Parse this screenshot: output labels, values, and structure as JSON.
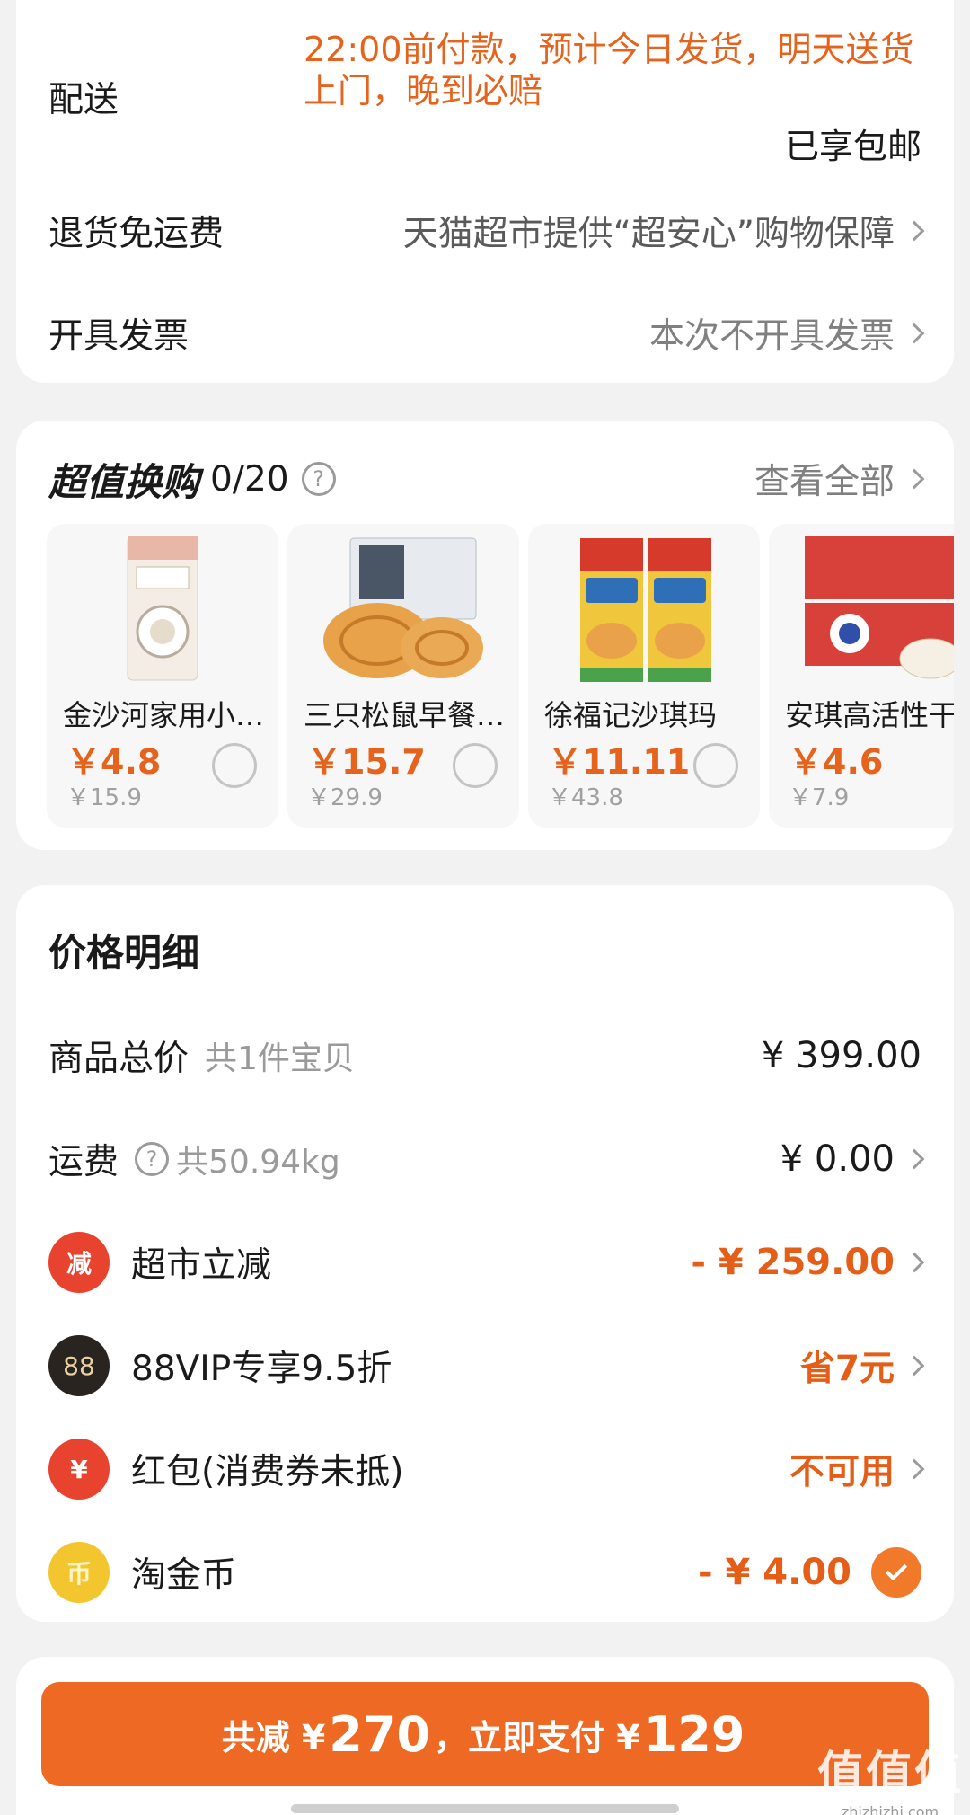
{
  "delivery": {
    "label": "配送",
    "note": "22:00前付款，预计今日发货，明天送货上门，晚到必赔",
    "free_shipping": "已享包邮"
  },
  "returns": {
    "label": "退货免运费",
    "value": "天猫超市提供“超安心”购物保障"
  },
  "invoice": {
    "label": "开具发票",
    "value": "本次不开具发票"
  },
  "exchange": {
    "title": "超值换购",
    "count": "0/20",
    "help_icon": "?",
    "view_all": "查看全部",
    "products": [
      {
        "name": "金沙河家用小麦粉",
        "price": "￥4.8",
        "original": "￥15.9"
      },
      {
        "name": "三只松鼠早餐手撕面包",
        "price": "￥15.7",
        "original": "￥29.9"
      },
      {
        "name": "徐福记沙琪玛",
        "price": "￥11.11",
        "original": "￥43.8"
      },
      {
        "name": "安琪高活性干酵母",
        "price": "￥4.6",
        "original": "￥7.9"
      }
    ]
  },
  "price_details": {
    "title": "价格明细",
    "total": {
      "label": "商品总价",
      "sub": "共1件宝贝",
      "value": "¥ 399.00"
    },
    "shipping": {
      "label": "运费",
      "help_icon": "?",
      "sub": "共50.94kg",
      "value": "¥ 0.00"
    },
    "supermarket": {
      "label": "超市立减",
      "icon_text": "减",
      "value": "- ¥ 259.00"
    },
    "vip": {
      "label": "88VIP专享9.5折",
      "icon_text": "88",
      "value": "省7元"
    },
    "redpacket": {
      "label": "红包(消费券未抵)",
      "icon_text": "¥",
      "value": "不可用"
    },
    "coins": {
      "label": "淘金币",
      "icon_text": "币",
      "value": "- ¥ 4.00"
    }
  },
  "pay_bar": {
    "prefix": "共减 ¥",
    "saved": "270",
    "middle": "，立即支付 ¥",
    "amount": "129"
  },
  "watermark": {
    "big": "值值值",
    "small": "zhizhizhi.com"
  },
  "colors": {
    "accent": "#ee6a24",
    "price_orange": "#e5631c",
    "background": "#f2f2f2"
  }
}
